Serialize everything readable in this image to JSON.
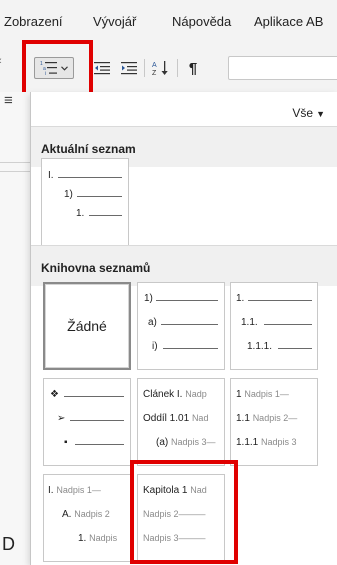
{
  "menu": {
    "items": [
      "Zobrazení",
      "Vývojář",
      "Nápověda",
      "Aplikace AB"
    ]
  },
  "toolbar": {
    "multilevel_list": "multilevel-list-icon",
    "decrease_indent": "decrease-indent-icon",
    "increase_indent": "increase-indent-icon",
    "sort": "sort-az-icon",
    "show_marks_label": "¶"
  },
  "left_strip": {
    "glyph": "≡",
    "letter": "D"
  },
  "panel": {
    "filter_label": "Vše",
    "current_section": {
      "title": "Aktuální seznam",
      "levels": [
        "I.",
        "1)",
        "1."
      ]
    },
    "library_section": {
      "title": "Knihovna seznamů",
      "tiles": [
        {
          "kind": "none",
          "label": "Žádné"
        },
        {
          "kind": "levels",
          "levels": [
            "1)",
            "a)",
            "i)"
          ]
        },
        {
          "kind": "levels",
          "levels": [
            "1.",
            "1.1.",
            "1.1.1."
          ]
        },
        {
          "kind": "bullets",
          "levels": [
            "❖",
            "➢",
            "▪"
          ]
        },
        {
          "kind": "headings",
          "levels": [
            {
              "num": "Článek I.",
              "text": "Nadp"
            },
            {
              "num": "Oddíl 1.01",
              "text": "Nad"
            },
            {
              "num": "(a)",
              "text": "Nadpis 3"
            }
          ]
        },
        {
          "kind": "headings",
          "levels": [
            {
              "num": "1",
              "text": "Nadpis 1"
            },
            {
              "num": "1.1",
              "text": "Nadpis 2"
            },
            {
              "num": "1.1.1",
              "text": "Nadpis 3"
            }
          ]
        },
        {
          "kind": "headings",
          "levels": [
            {
              "num": "I.",
              "text": "Nadpis 1"
            },
            {
              "num": "A.",
              "text": "Nadpis 2"
            },
            {
              "num": "1.",
              "text": "Nadpis"
            }
          ]
        },
        {
          "kind": "headings",
          "levels": [
            {
              "num": "Kapitola 1",
              "text": "Nad"
            },
            {
              "num": "",
              "text": "Nadpis 2"
            },
            {
              "num": "",
              "text": "Nadpis 3"
            }
          ]
        }
      ]
    }
  },
  "highlight_color": "#e00000"
}
